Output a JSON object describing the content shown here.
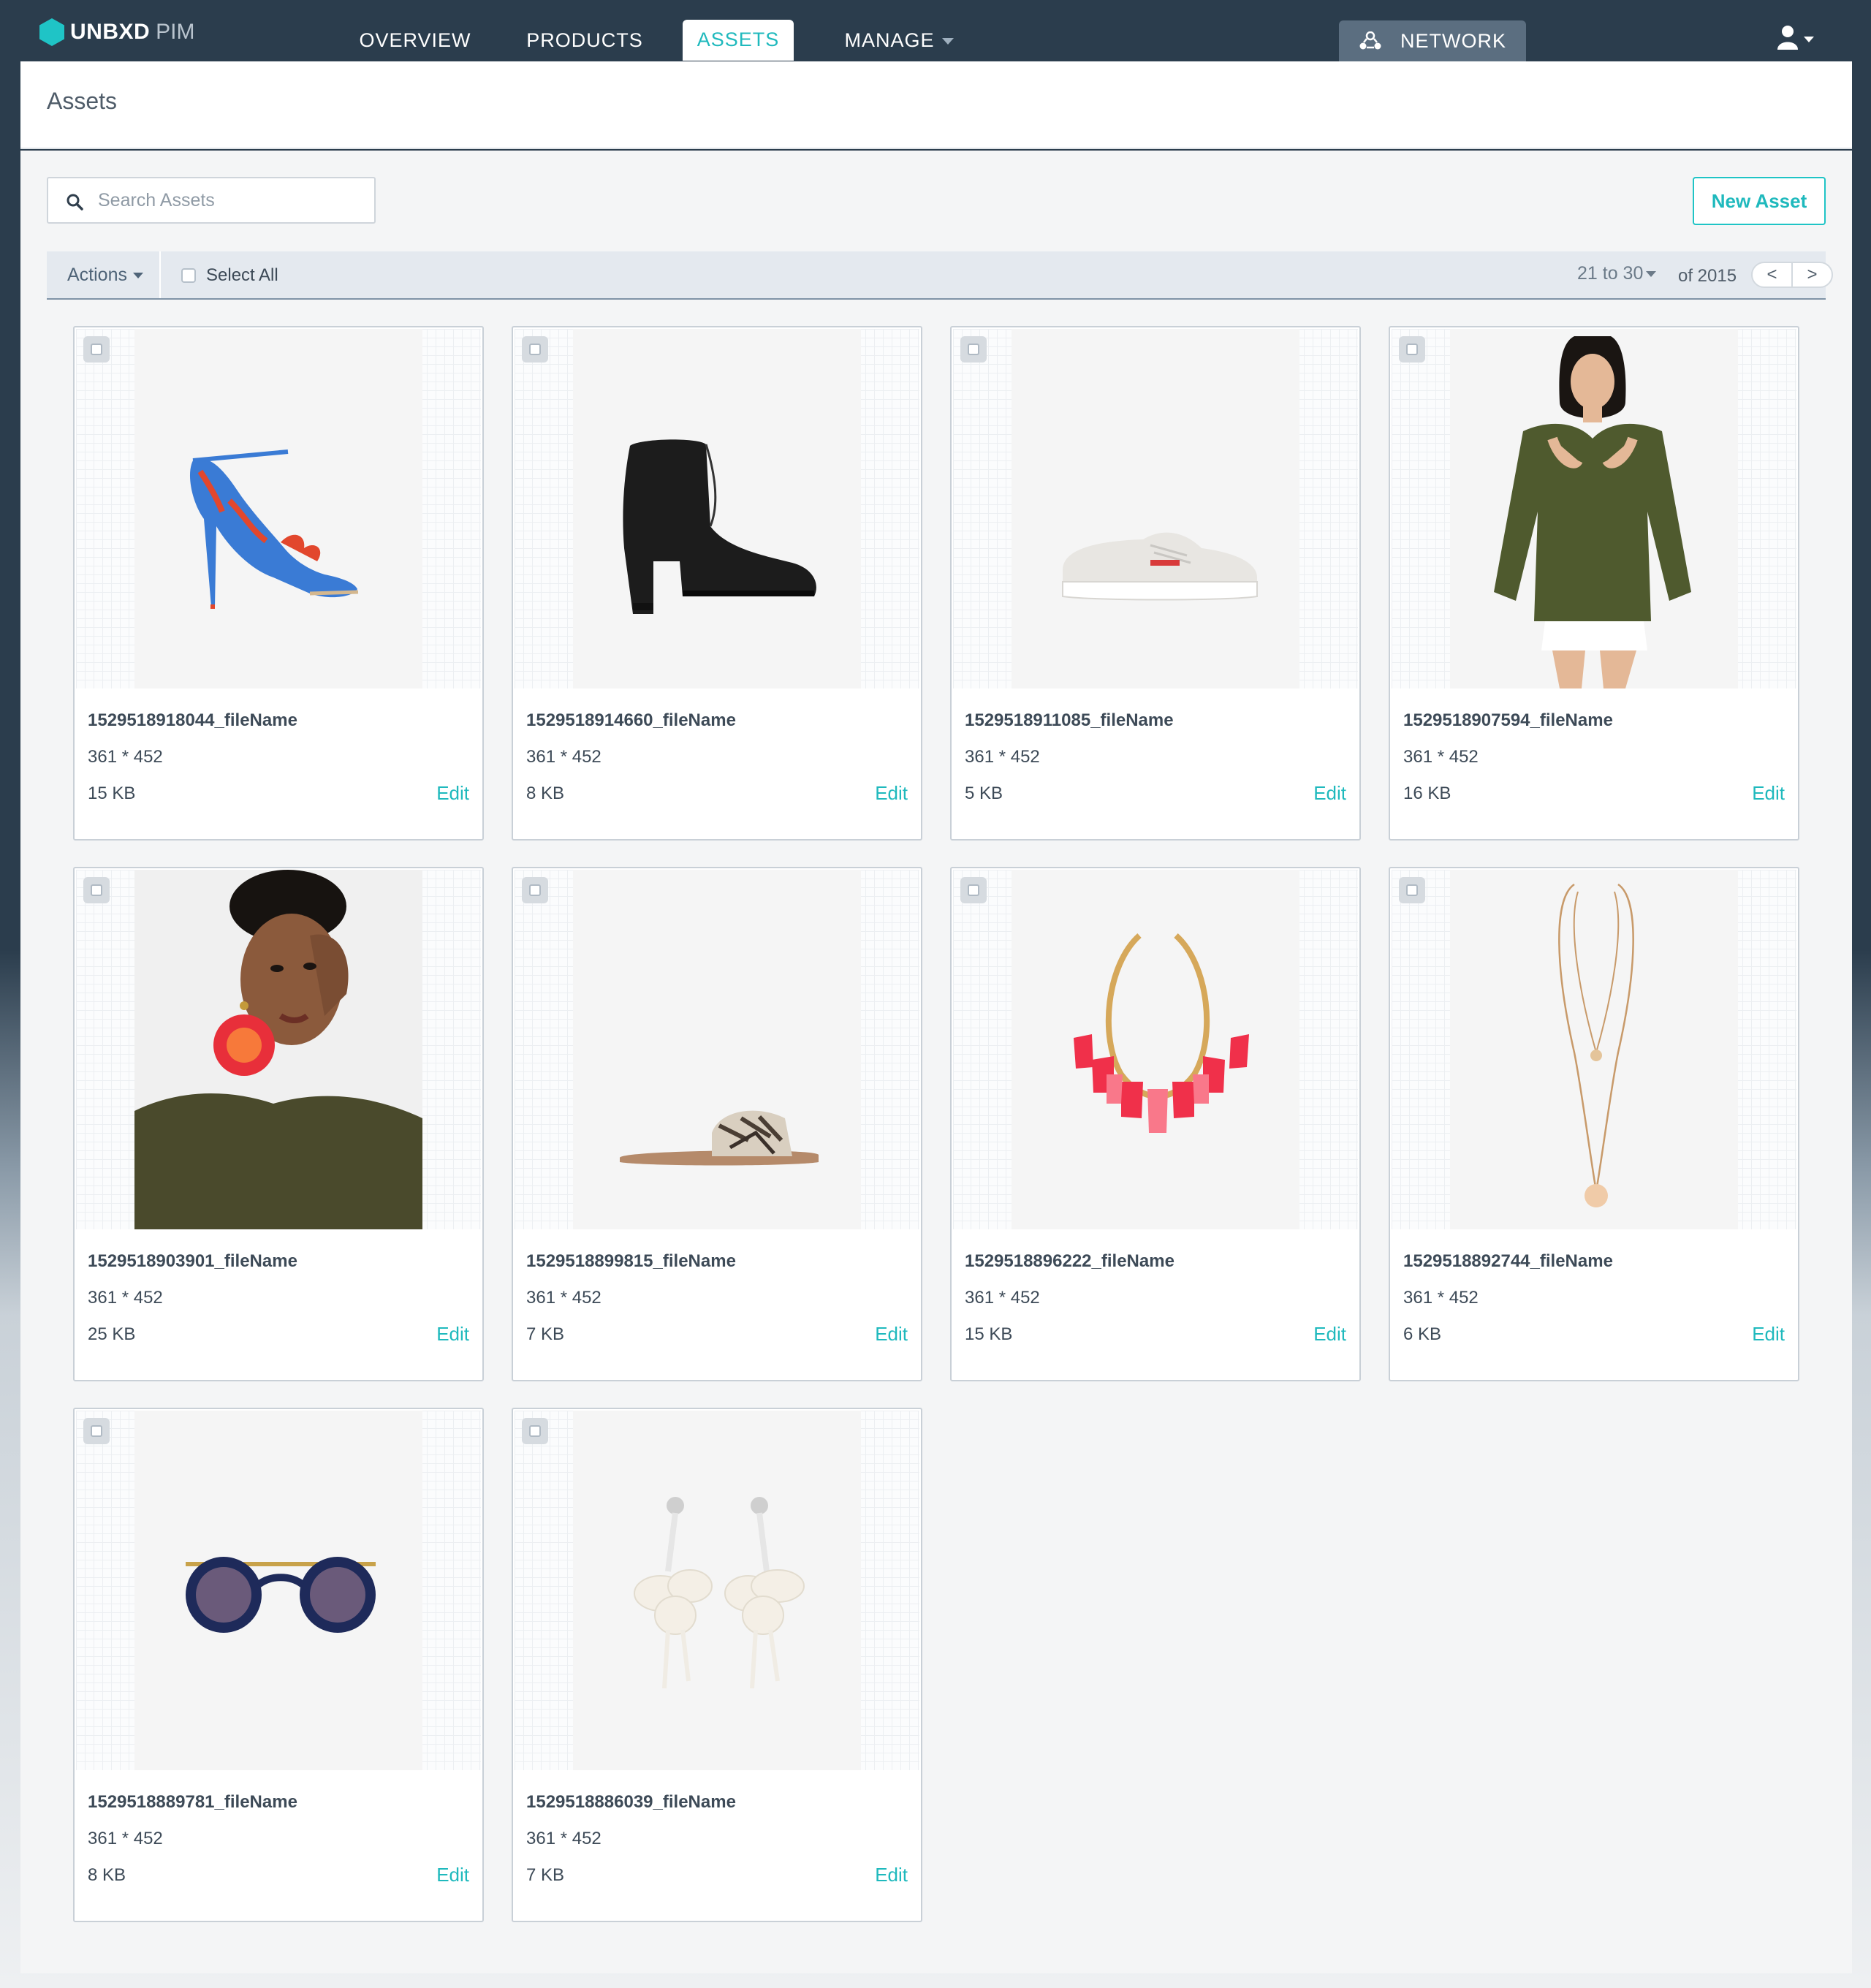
{
  "brand": {
    "name": "UNBXD",
    "product": "PIM",
    "accent": "#1fc4c6"
  },
  "nav": {
    "items": [
      {
        "label": "OVERVIEW"
      },
      {
        "label": "PRODUCTS"
      },
      {
        "label": "ASSETS",
        "active": true
      },
      {
        "label": "MANAGE",
        "dropdown": true
      }
    ],
    "network": {
      "label": "NETWORK",
      "icon": "network-icon"
    },
    "user_icon": "user-icon"
  },
  "page": {
    "title": "Assets"
  },
  "search": {
    "placeholder": "Search Assets",
    "value": ""
  },
  "new_asset_label": "New Asset",
  "toolbar": {
    "actions_label": "Actions",
    "select_all_label": "Select All",
    "range": "21 to 30",
    "total": "of 2015",
    "prev": "<",
    "next": ">"
  },
  "assets": [
    {
      "file_name": "1529518918044_fileName",
      "dimensions": "361 * 452",
      "size": "15 KB",
      "edit": "Edit",
      "image": "floral-heeled-sandal"
    },
    {
      "file_name": "1529518914660_fileName",
      "dimensions": "361 * 452",
      "size": "8 KB",
      "edit": "Edit",
      "image": "black-ankle-boot"
    },
    {
      "file_name": "1529518911085_fileName",
      "dimensions": "361 * 452",
      "size": "5 KB",
      "edit": "Edit",
      "image": "white-sneaker"
    },
    {
      "file_name": "1529518907594_fileName",
      "dimensions": "361 * 452",
      "size": "16 KB",
      "edit": "Edit",
      "image": "model-green-cold-shoulder-top"
    },
    {
      "file_name": "1529518903901_fileName",
      "dimensions": "361 * 452",
      "size": "25 KB",
      "edit": "Edit",
      "image": "model-tassel-earring"
    },
    {
      "file_name": "1529518899815_fileName",
      "dimensions": "361 * 452",
      "size": "7 KB",
      "edit": "Edit",
      "image": "snakeskin-slide-sandal"
    },
    {
      "file_name": "1529518896222_fileName",
      "dimensions": "361 * 452",
      "size": "15 KB",
      "edit": "Edit",
      "image": "pink-tassel-necklace"
    },
    {
      "file_name": "1529518892744_fileName",
      "dimensions": "361 * 452",
      "size": "6 KB",
      "edit": "Edit",
      "image": "layered-gold-necklace"
    },
    {
      "file_name": "1529518889781_fileName",
      "dimensions": "361 * 452",
      "size": "8 KB",
      "edit": "Edit",
      "image": "round-sunglasses"
    },
    {
      "file_name": "1529518886039_fileName",
      "dimensions": "361 * 452",
      "size": "7 KB",
      "edit": "Edit",
      "image": "white-floral-drop-earrings"
    }
  ]
}
